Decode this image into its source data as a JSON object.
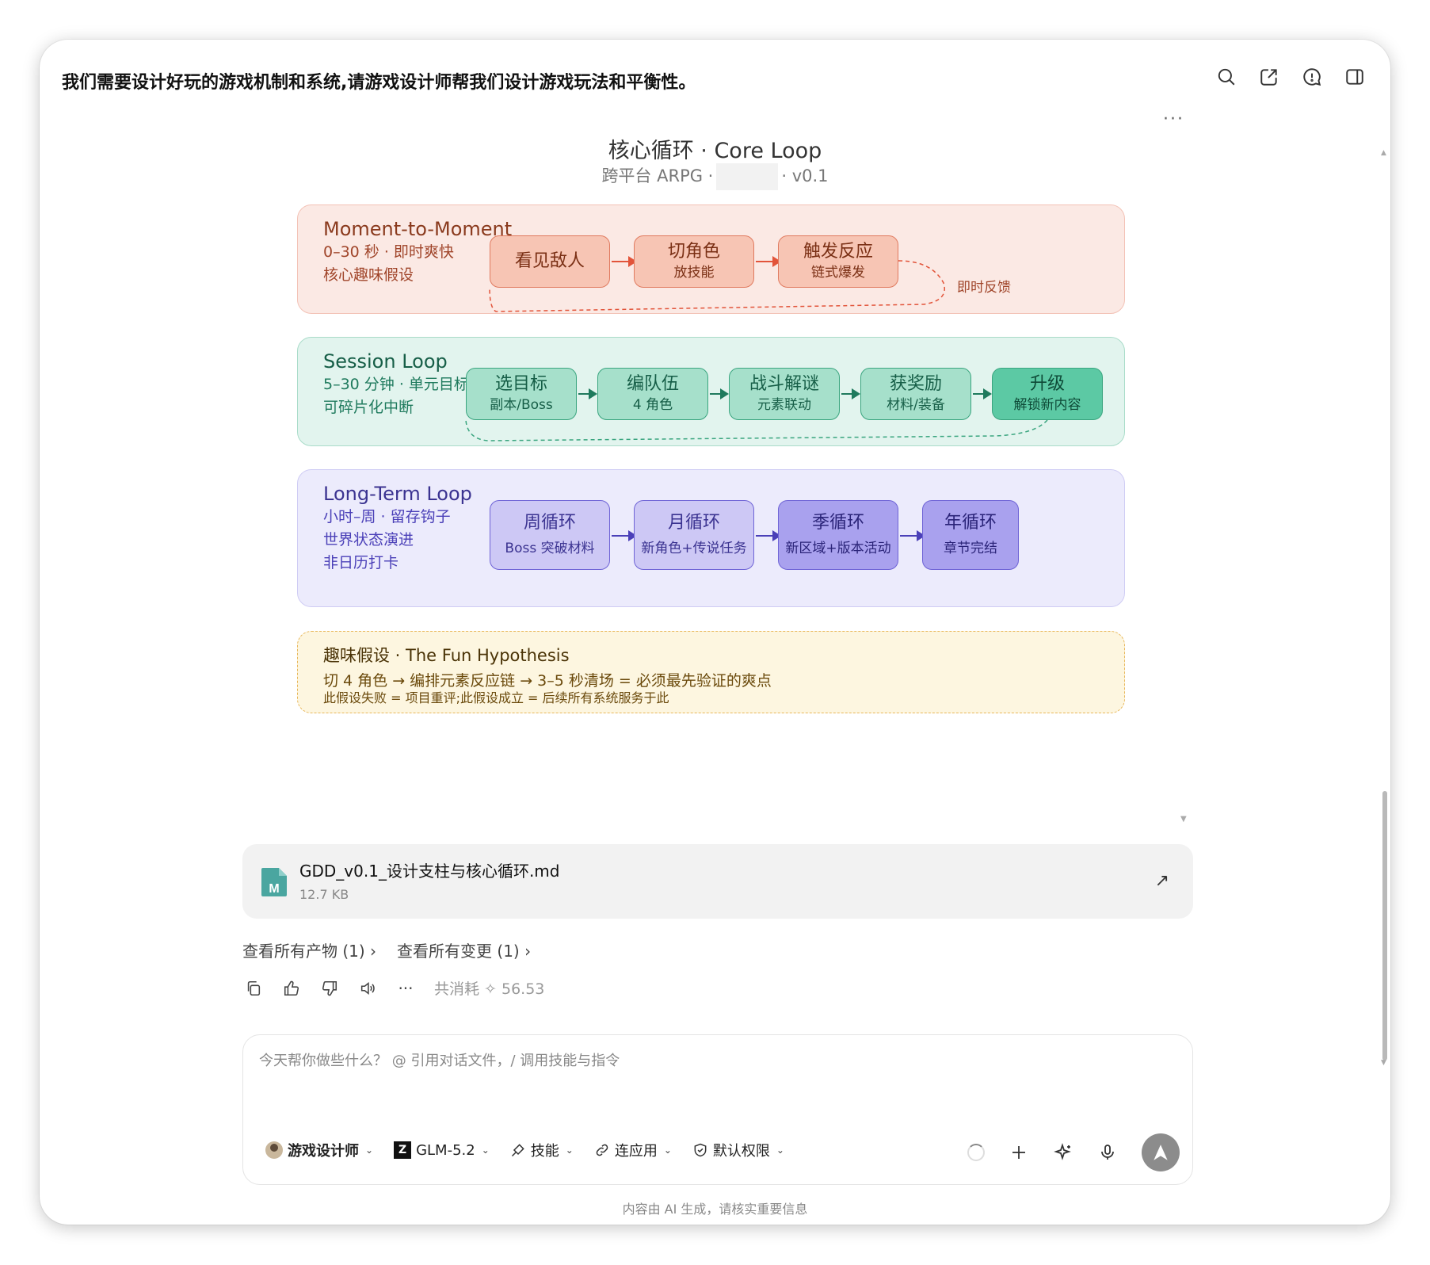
{
  "header": {
    "title": "我们需要设计好玩的游戏机制和系统,请游戏设计师帮我们设计游戏玩法和平衡性。",
    "icons": [
      "search-icon",
      "share-icon",
      "feedback-icon",
      "sidebar-icon"
    ],
    "more": "···"
  },
  "diagram": {
    "title": "核心循环 · Core Loop",
    "subtitle_prefix": "跨平台 ARPG ·",
    "subtitle_suffix": "· v0.1",
    "moment": {
      "name": "Moment-to-Moment",
      "desc1": "0–30 秒 · 即时爽快",
      "desc2": "核心趣味假设",
      "nodes": [
        {
          "title": "看见敌人",
          "sub": ""
        },
        {
          "title": "切角色",
          "sub": "放技能"
        },
        {
          "title": "触发反应",
          "sub": "链式爆发"
        }
      ],
      "feedback_label": "即时反馈",
      "colors": {
        "bg": "#fbe9e4",
        "border": "#f3c2b6",
        "node": "#f7c5b4",
        "node_border": "#e07a5f",
        "text": "#8a3a1d",
        "arrow": "#e2543a"
      }
    },
    "session": {
      "name": "Session Loop",
      "desc1": "5–30 分钟 · 单元目标",
      "desc2": "可碎片化中断",
      "nodes": [
        {
          "title": "选目标",
          "sub": "副本/Boss"
        },
        {
          "title": "编队伍",
          "sub": "4 角色"
        },
        {
          "title": "战斗解谜",
          "sub": "元素联动"
        },
        {
          "title": "获奖励",
          "sub": "材料/装备"
        },
        {
          "title": "升级",
          "sub": "解锁新内容"
        }
      ],
      "colors": {
        "bg": "#e2f4ee",
        "border": "#a9dcc9",
        "node": "#a6e0cb",
        "node_last": "#5cc9a4",
        "node_border": "#3aa57f",
        "text": "#165e47",
        "arrow": "#1f7a5d"
      }
    },
    "longterm": {
      "name": "Long-Term Loop",
      "desc1": "小时–周 · 留存钩子",
      "desc2": "世界状态演进",
      "desc3": "非日历打卡",
      "nodes": [
        {
          "title": "周循环",
          "sub": "Boss 突破材料"
        },
        {
          "title": "月循环",
          "sub": "新角色+传说任务"
        },
        {
          "title": "季循环",
          "sub": "新区域+版本活动"
        },
        {
          "title": "年循环",
          "sub": "章节完结"
        }
      ],
      "colors": {
        "bg": "#ecebfc",
        "border": "#cfccf4",
        "node": "#cdc8f5",
        "node_dark": "#a9a1ee",
        "node_border": "#6e63d6",
        "text": "#3b3391",
        "arrow": "#4b40b8"
      }
    },
    "fun": {
      "title": "趣味假设 · The Fun Hypothesis",
      "line1": "切 4 角色 → 编排元素反应链 → 3–5 秒清场 = 必须最先验证的爽点",
      "line2": "此假设失败 = 项目重评;此假设成立 = 后续所有系统服务于此",
      "colors": {
        "bg": "#fdf6e0",
        "border": "#e8b75a",
        "text": "#6b4a0c"
      }
    }
  },
  "file": {
    "name": "GDD_v0.1_设计支柱与核心循环.md",
    "size": "12.7 KB",
    "icon": "markdown-file-icon"
  },
  "links": {
    "artifacts": "查看所有产物 (1) ›",
    "changes": "查看所有变更 (1) ›"
  },
  "actions": {
    "icons": [
      "copy-icon",
      "thumbs-up-icon",
      "thumbs-down-icon",
      "speaker-icon",
      "more-icon"
    ],
    "usage": "共消耗 ✧ 56.53"
  },
  "composer": {
    "placeholder": "今天帮你做些什么？ @ 引用对话文件，/ 调用技能与指令",
    "agent": "游戏设计师",
    "model": "GLM-5.2",
    "skills": "技能",
    "apps": "连应用",
    "permission": "默认权限"
  },
  "footer": {
    "disclaimer": "内容由 AI 生成，请核实重要信息"
  }
}
